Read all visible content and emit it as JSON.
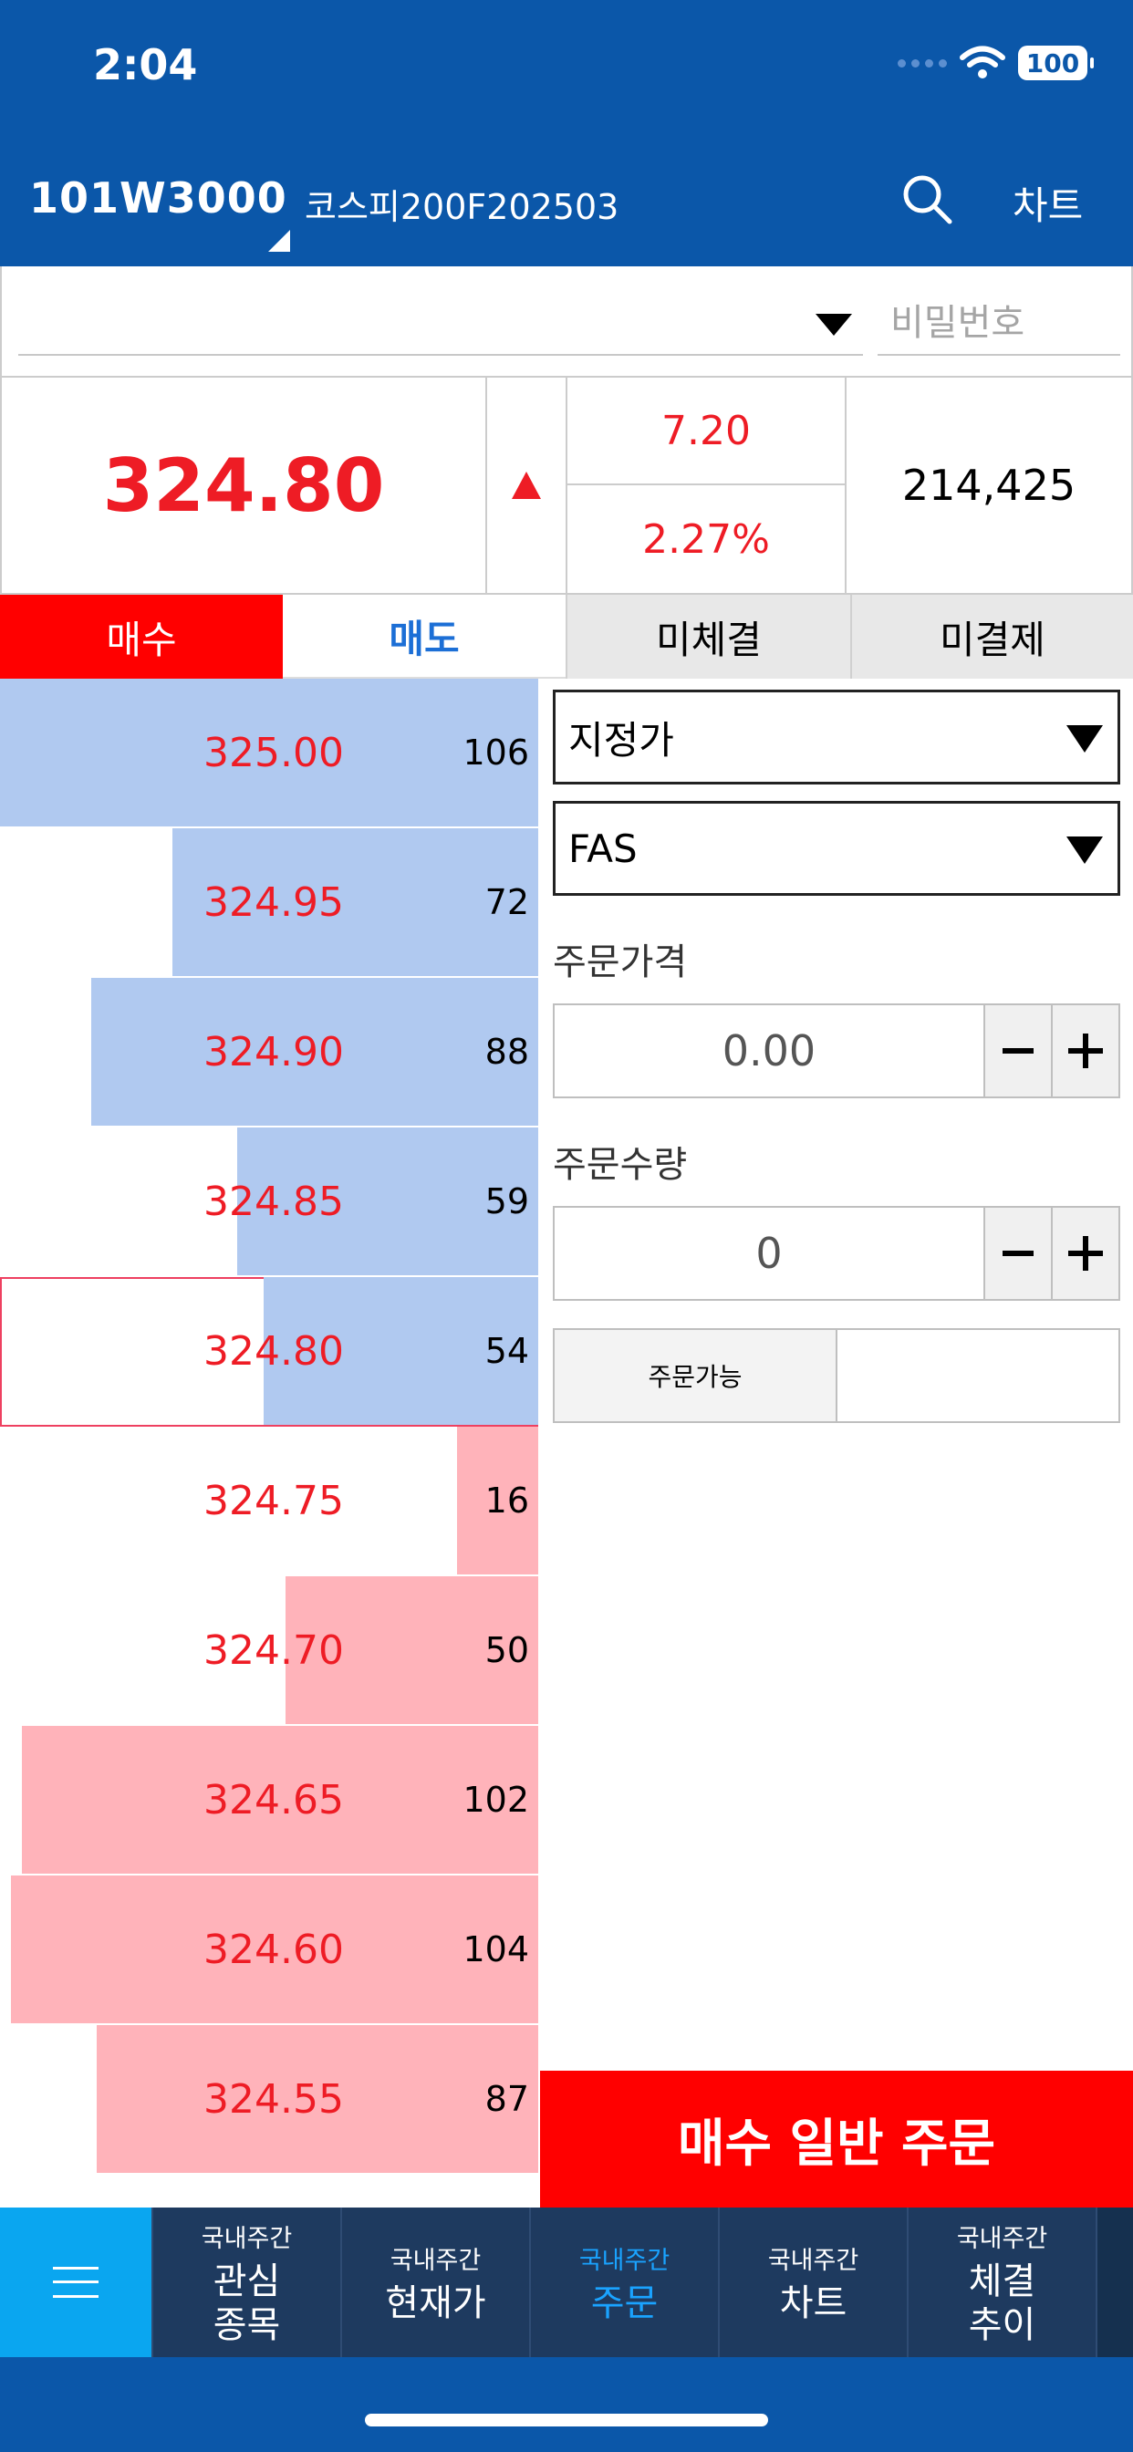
{
  "status_bar": {
    "time": "2:04",
    "battery": "100"
  },
  "header": {
    "code": "101W3000",
    "name": "코스피200F202503",
    "chart_label": "차트"
  },
  "account": {
    "password_placeholder": "비밀번호"
  },
  "quote": {
    "price": "324.80",
    "change": "7.20",
    "change_pct": "2.27%",
    "volume": "214,425",
    "direction": "up"
  },
  "tabs": [
    {
      "label": "매수"
    },
    {
      "label": "매도"
    },
    {
      "label": "미체결"
    },
    {
      "label": "미결제"
    }
  ],
  "order_book": [
    {
      "price": "325.00",
      "qty": "106",
      "side": "ask",
      "level": 1.0
    },
    {
      "price": "324.95",
      "qty": "72",
      "side": "ask",
      "level": 0.68
    },
    {
      "price": "324.90",
      "qty": "88",
      "side": "ask",
      "level": 0.83
    },
    {
      "price": "324.85",
      "qty": "59",
      "side": "ask",
      "level": 0.56
    },
    {
      "price": "324.80",
      "qty": "54",
      "side": "ask",
      "level": 0.51,
      "current": true
    },
    {
      "price": "324.75",
      "qty": "16",
      "side": "bid",
      "level": 0.15
    },
    {
      "price": "324.70",
      "qty": "50",
      "side": "bid",
      "level": 0.47
    },
    {
      "price": "324.65",
      "qty": "102",
      "side": "bid",
      "level": 0.96
    },
    {
      "price": "324.60",
      "qty": "104",
      "side": "bid",
      "level": 0.98
    },
    {
      "price": "324.55",
      "qty": "87",
      "side": "bid",
      "level": 0.82
    }
  ],
  "order_form": {
    "order_type": "지정가",
    "condition": "FAS",
    "price_label": "주문가격",
    "price_value": "0.00",
    "qty_label": "주문수량",
    "qty_value": "0",
    "available_label": "주문가능",
    "available_value": "",
    "submit_label": "매수 일반 주문"
  },
  "bottom_nav": [
    {
      "sub": "국내주간",
      "main": "관심\n종목"
    },
    {
      "sub": "국내주간",
      "main": "현재가"
    },
    {
      "sub": "국내주간",
      "main": "주문",
      "active": true
    },
    {
      "sub": "국내주간",
      "main": "차트"
    },
    {
      "sub": "국내주간",
      "main": "체결\n추이"
    }
  ],
  "colors": {
    "header": "#0B57A9",
    "up": "#ee1c25",
    "ask_bar": "#b0c9f0",
    "bid_bar": "#ffb3ba",
    "nav_active": "#1aa3ff"
  },
  "icons": {
    "search": "search-icon",
    "menu": "hamburger-icon",
    "dropdown": "triangle-down-icon"
  }
}
